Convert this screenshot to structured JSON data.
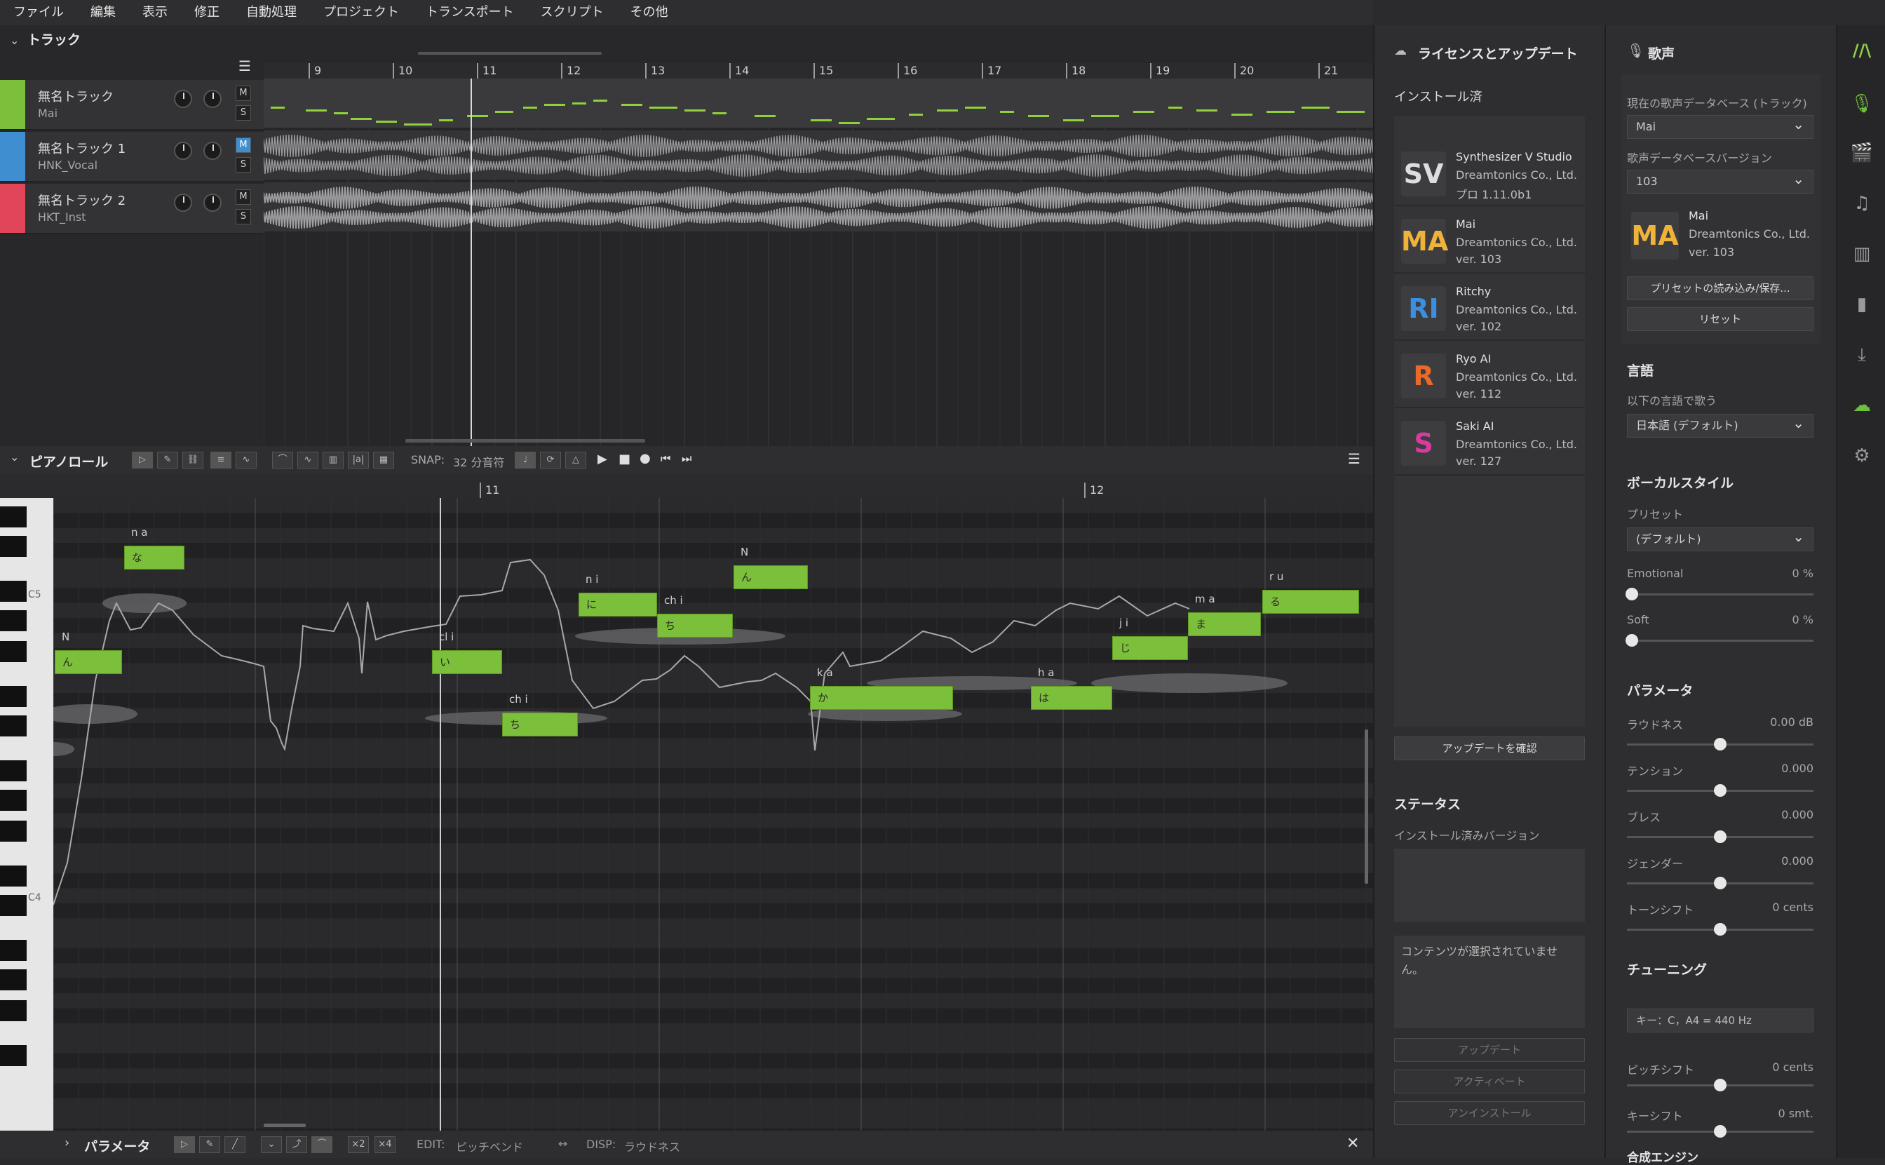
{
  "menu": [
    "ファイル",
    "編集",
    "表示",
    "修正",
    "自動処理",
    "プロジェクト",
    "トランスポート",
    "スクリプト",
    "その他"
  ],
  "tracks_panel": {
    "title": "トラック"
  },
  "ruler_top": [
    "9",
    "10",
    "11",
    "12",
    "13",
    "14",
    "15",
    "16",
    "17",
    "18",
    "19",
    "20",
    "21"
  ],
  "tracks": [
    {
      "name": "無名トラック",
      "sub": "Mai",
      "color": "#7cbf3a",
      "m_on": false
    },
    {
      "name": "無名トラック 1",
      "sub": "HNK_Vocal",
      "color": "#3e8ed0",
      "m_on": true
    },
    {
      "name": "無名トラック 2",
      "sub": "HKT_Inst",
      "color": "#e0455a",
      "m_on": false
    }
  ],
  "track_buttons": {
    "m": "M",
    "s": "S"
  },
  "pianoroll": {
    "title": "ピアノロール",
    "snap_label": "SNAP:",
    "snap_value": "32 分音符",
    "ruler": [
      "11",
      "12"
    ],
    "key_labels": [
      "C5",
      "C4"
    ],
    "notes": [
      {
        "lyric": "n",
        "char": "ん",
        "phon": "N"
      },
      {
        "lyric": "na",
        "char": "な",
        "phon": "n a"
      },
      {
        "lyric": "i",
        "char": "い",
        "phon": "cl i"
      },
      {
        "lyric": "chi",
        "char": "ち",
        "phon": "ch i"
      },
      {
        "lyric": "ni",
        "char": "に",
        "phon": "n i"
      },
      {
        "lyric": "chi",
        "char": "ち",
        "phon": "ch i"
      },
      {
        "lyric": "n",
        "char": "ん",
        "phon": "N"
      },
      {
        "lyric": "ka",
        "char": "か",
        "phon": "k a"
      },
      {
        "lyric": "ha",
        "char": "は",
        "phon": "h a"
      },
      {
        "lyric": "ji",
        "char": "じ",
        "phon": "j i"
      },
      {
        "lyric": "ma",
        "char": "ま",
        "phon": "m a"
      },
      {
        "lyric": "ru",
        "char": "る",
        "phon": "r u"
      }
    ],
    "toolbar_icons": [
      "pointer-icon",
      "pen-icon",
      "link-icon",
      "align-icon",
      "curve-icon",
      "pitch-icon",
      "vibrato-icon",
      "waveform-icon",
      "phoneme-icon",
      "film-icon"
    ]
  },
  "param_bar": {
    "title": "パラメータ",
    "edit_label": "EDIT:",
    "edit_value": "ピッチベンド",
    "disp_label": "DISP:",
    "disp_value": "ラウドネス",
    "x2": "×2",
    "x4": "×4"
  },
  "license": {
    "title": "ライセンスとアップデート",
    "installed": "インストール済",
    "packages": [
      {
        "name": "Synthesizer V Studio",
        "vendor": "Dreamtonics Co., Ltd.",
        "ver": "プロ 1.11.0b1",
        "icon": "SV",
        "color": "#dddddd"
      },
      {
        "name": "Mai",
        "vendor": "Dreamtonics Co., Ltd.",
        "ver": "ver. 103",
        "icon": "MA",
        "color": "#f0b33a"
      },
      {
        "name": "Ritchy",
        "vendor": "Dreamtonics Co., Ltd.",
        "ver": "ver. 102",
        "icon": "RI",
        "color": "#3a8fe0"
      },
      {
        "name": "Ryo AI",
        "vendor": "Dreamtonics Co., Ltd.",
        "ver": "ver. 112",
        "icon": "R",
        "color": "#e86a2a"
      },
      {
        "name": "Saki AI",
        "vendor": "Dreamtonics Co., Ltd.",
        "ver": "ver. 127",
        "icon": "S",
        "color": "#d83aa0"
      }
    ],
    "check_update": "アップデートを確認",
    "status_title": "ステータス",
    "installed_version": "インストール済みバージョン",
    "no_content": "コンテンツが選択されていません。",
    "update": "アップデート",
    "activate": "アクティベート",
    "uninstall": "アンインストール"
  },
  "voice": {
    "title": "歌声",
    "db_label": "現在の歌声データベース (トラック)",
    "db_value": "Mai",
    "db_ver_label": "歌声データベースバージョン",
    "db_ver_value": "103",
    "card": {
      "name": "Mai",
      "vendor": "Dreamtonics Co., Ltd.",
      "ver": "ver. 103"
    },
    "preset_btn": "プリセットの読み込み/保存...",
    "reset_btn": "リセット",
    "language_title": "言語",
    "language_label": "以下の言語で歌う",
    "language_value": "日本語 (デフォルト)",
    "vocal_style_title": "ボーカルスタイル",
    "preset_label": "プリセット",
    "preset_value": "(デフォルト)",
    "emotional": {
      "label": "Emotional",
      "value": "0 %"
    },
    "soft": {
      "label": "Soft",
      "value": "0 %"
    },
    "params_title": "パラメータ",
    "params": [
      {
        "label": "ラウドネス",
        "value": "0.00 dB"
      },
      {
        "label": "テンション",
        "value": "0.000"
      },
      {
        "label": "ブレス",
        "value": "0.000"
      },
      {
        "label": "ジェンダー",
        "value": "0.000"
      },
      {
        "label": "トーンシフト",
        "value": "0 cents"
      }
    ],
    "tuning_title": "チューニング",
    "key_value": "キー：C，A4 = 440 Hz",
    "pitch_shift": {
      "label": "ピッチシフト",
      "value": "0 cents"
    },
    "key_shift": {
      "label": "キーシフト",
      "value": "0 smt."
    },
    "engine_title": "合成エンジン"
  },
  "sidebar_icons": [
    "logo-icon",
    "microphone-icon",
    "clapperboard-icon",
    "music-note-icon",
    "library-icon",
    "book-icon",
    "import-icon",
    "cloud-check-icon",
    "gear-icon"
  ]
}
